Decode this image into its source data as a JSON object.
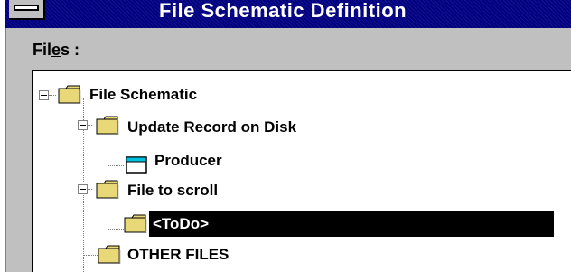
{
  "window": {
    "title": "File Schematic Definition"
  },
  "files_label": {
    "before": "Fil",
    "mnemonic": "e",
    "after": "s :"
  },
  "tree": {
    "items": [
      {
        "label": "File Schematic",
        "icon": "folder-icon",
        "expanded": true,
        "selected": false
      },
      {
        "label": "Update Record on Disk",
        "icon": "folder-icon",
        "expanded": true,
        "selected": false
      },
      {
        "label": "Producer",
        "icon": "window-icon",
        "expanded": false,
        "selected": false
      },
      {
        "label": "File to scroll",
        "icon": "folder-icon",
        "expanded": true,
        "selected": false
      },
      {
        "label": "<ToDo>",
        "icon": "folder-icon",
        "expanded": false,
        "selected": true
      },
      {
        "label": "OTHER FILES",
        "icon": "folder-icon",
        "expanded": false,
        "selected": false
      }
    ]
  },
  "colors": {
    "titlebar": "#000080",
    "window_bg": "#c0c0c0",
    "folder": "#e8d878",
    "selection": "#000000"
  }
}
